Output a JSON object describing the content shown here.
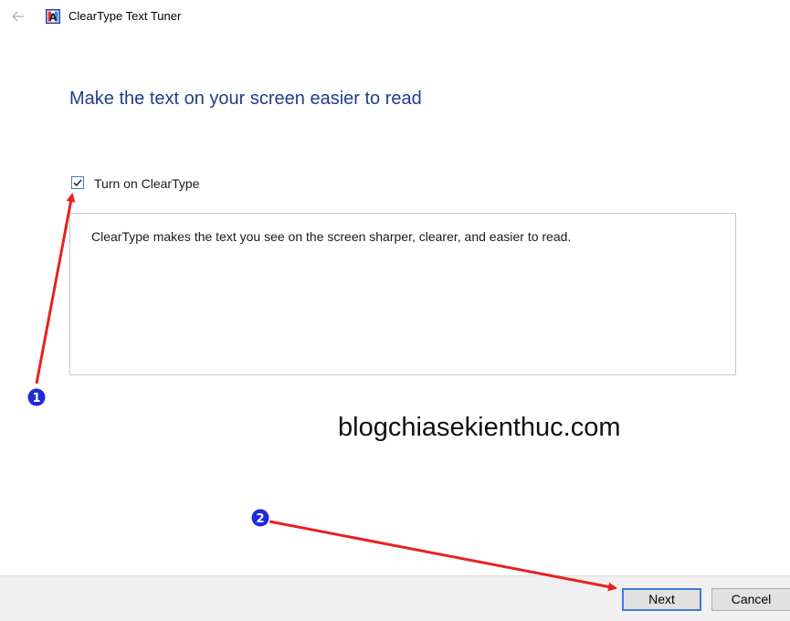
{
  "window": {
    "title": "ClearType Text Tuner",
    "back_icon": "back-arrow-icon",
    "app_icon": "cleartype-app-icon"
  },
  "main": {
    "heading": "Make the text on your screen easier to read",
    "checkbox": {
      "label": "Turn on ClearType",
      "checked": true
    },
    "description": "ClearType makes the text you see on the screen sharper, clearer, and easier to read."
  },
  "watermark": "blogchiasekienthuc.com",
  "footer": {
    "next_label": "Next",
    "cancel_label": "Cancel"
  },
  "annotations": {
    "marker_1": "1",
    "marker_2": "2",
    "arrow_color": "#e8211f",
    "marker_color": "#1f2bd6"
  },
  "colors": {
    "heading": "#1e3e8c",
    "checkbox_border": "#4a78c8",
    "footer_bg": "#f0f0f0",
    "focus_border": "#3c7dd9"
  }
}
